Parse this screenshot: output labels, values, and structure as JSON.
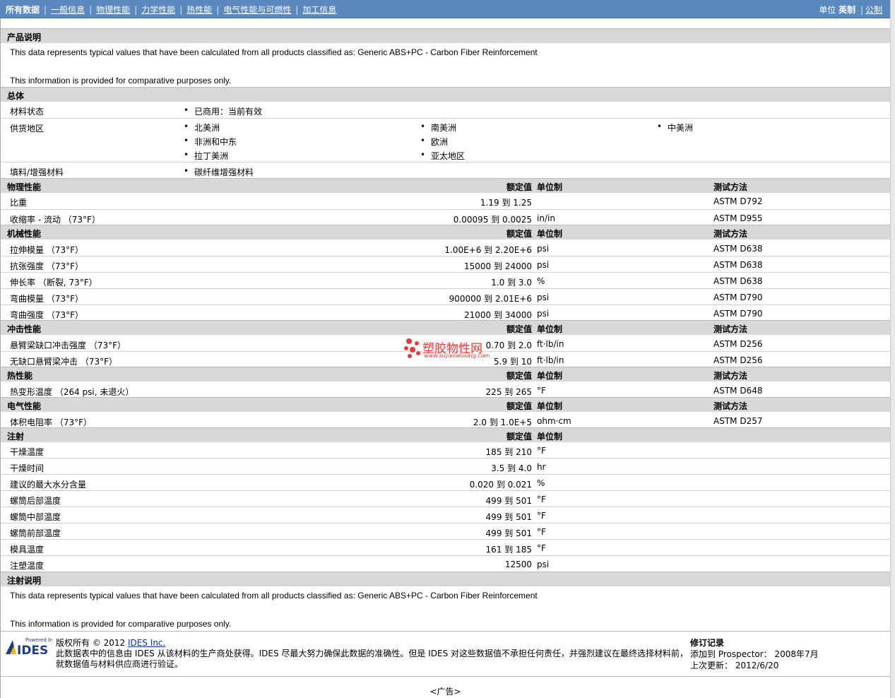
{
  "nav": {
    "items": [
      "所有数据",
      "一般信息",
      "物理性能",
      "力学性能",
      "热性能",
      "电气性能与可燃性",
      "加工信息"
    ],
    "units_label": "单位",
    "unit_selected": "英制",
    "unit_other": "公制"
  },
  "product_note": {
    "title": "产品说明",
    "line1": "This data represents typical values that have been calculated from all products classified as: Generic ABS+PC - Carbon Fiber Reinforcement",
    "line2": "This information is provided for comparative purposes only."
  },
  "general": {
    "title": "总体",
    "material_status_label": "材料状态",
    "material_status": "已商用：当前有效",
    "supply_label": "供货地区",
    "regions": [
      "北美洲",
      "南美洲",
      "中美洲",
      "非洲和中东",
      "欧洲",
      "拉丁美洲",
      "亚太地区"
    ],
    "filler_label": "填料/增强材料",
    "filler": "碳纤维增强材料"
  },
  "headers": {
    "nominal": "额定值",
    "unit": "单位制",
    "method": "测试方法"
  },
  "physical": {
    "title": "物理性能",
    "rows": [
      {
        "name": "比重",
        "value": "1.19 到  1.25",
        "unit": "",
        "method": "ASTM D792"
      },
      {
        "name": "收缩率  - 流动 （73°F）",
        "value": "0.00095 到  0.0025",
        "unit": "in/in",
        "method": "ASTM D955"
      }
    ]
  },
  "mechanical": {
    "title": "机械性能",
    "rows": [
      {
        "name": "拉伸模量 （73°F）",
        "value": "1.00E+6 到  2.20E+6",
        "unit": "psi",
        "method": "ASTM D638"
      },
      {
        "name": "抗张强度 （73°F）",
        "value": "15000 到  24000",
        "unit": "psi",
        "method": "ASTM D638"
      },
      {
        "name": "伸长率 （断裂, 73°F）",
        "value": "1.0 到  3.0",
        "unit": "%",
        "method": "ASTM D638"
      },
      {
        "name": "弯曲模量 （73°F）",
        "value": "900000 到  2.01E+6",
        "unit": "psi",
        "method": "ASTM D790"
      },
      {
        "name": "弯曲强度 （73°F）",
        "value": "21000 到  34000",
        "unit": "psi",
        "method": "ASTM D790"
      }
    ]
  },
  "impact": {
    "title": "冲击性能",
    "rows": [
      {
        "name": "悬臂梁缺口冲击强度 （73°F）",
        "value": "0.70 到  2.0",
        "unit": "ft·lb/in",
        "method": "ASTM D256"
      },
      {
        "name": "无缺口悬臂梁冲击 （73°F）",
        "value": "5.9 到  10",
        "unit": "ft·lb/in",
        "method": "ASTM D256"
      }
    ]
  },
  "thermal": {
    "title": "热性能",
    "rows": [
      {
        "name": "热变形温度 （264 psi, 未退火）",
        "value": "225 到  265",
        "unit": "°F",
        "method": "ASTM D648"
      }
    ]
  },
  "electrical": {
    "title": "电气性能",
    "rows": [
      {
        "name": "体积电阻率 （73°F）",
        "value": "2.0 到  1.0E+5",
        "unit": "ohm·cm",
        "method": "ASTM D257"
      }
    ]
  },
  "injection": {
    "title": "注射",
    "rows": [
      {
        "name": "干燥温度",
        "value": "185 到  210",
        "unit": "°F"
      },
      {
        "name": "干燥时间",
        "value": "3.5 到  4.0",
        "unit": "hr"
      },
      {
        "name": "建议的最大水分含量",
        "value": "0.020 到  0.021",
        "unit": "%"
      },
      {
        "name": "螺筒后部温度",
        "value": "499 到  501",
        "unit": "°F"
      },
      {
        "name": "螺筒中部温度",
        "value": "499 到  501",
        "unit": "°F"
      },
      {
        "name": "螺筒前部温度",
        "value": "499 到  501",
        "unit": "°F"
      },
      {
        "name": "模具温度",
        "value": "161 到  185",
        "unit": "°F"
      },
      {
        "name": "注塑温度",
        "value": "12500",
        "unit": "psi"
      }
    ]
  },
  "injection_note": {
    "title": "注射说明",
    "line1": "This data represents typical values that have been calculated from all products classified as: Generic ABS+PC - Carbon Fiber Reinforcement",
    "line2": "This information is provided for comparative purposes only."
  },
  "footer": {
    "logo_powered": "Powered by",
    "logo_text": "IDES",
    "copyright_prefix": "版权所有 © 2012 ",
    "copyright_link": "IDES Inc.",
    "disclaimer1": "此数据表中的信息由  IDES 从该材料的生产商处获得。IDES 尽最大努力确保此数据的准确性。但是  IDES 对这些数据值不承担任何责任，并强烈建议在最终选择材料前，",
    "disclaimer2": "就数据值与材料供应商进行验证。",
    "revision_title": "修订记录",
    "added_label": "添加到  Prospector：  2008年7月",
    "updated_label": "上次更新：  2012/6/20",
    "ad": "<广告>"
  },
  "watermark": {
    "text": "塑胶物性网",
    "url": "www.sujiaowuxing.com"
  },
  "colors": {
    "topbar": "#5a89c0",
    "section": "#d8d8d8",
    "watermark": "#e83a3a"
  }
}
